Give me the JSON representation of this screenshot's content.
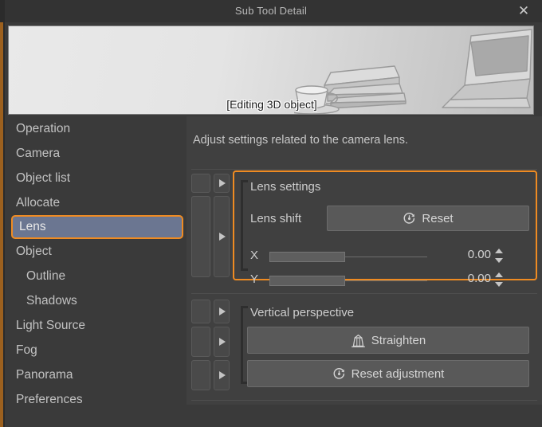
{
  "window": {
    "title": "Sub Tool Detail",
    "close_icon": "close-icon"
  },
  "preview": {
    "label": "[Editing 3D object]",
    "scene_objects": [
      "books",
      "coffee-cup",
      "laptop"
    ]
  },
  "sidebar": {
    "items": [
      {
        "label": "Operation",
        "selected": false,
        "sub": false
      },
      {
        "label": "Camera",
        "selected": false,
        "sub": false
      },
      {
        "label": "Object list",
        "selected": false,
        "sub": false
      },
      {
        "label": "Allocate",
        "selected": false,
        "sub": false
      },
      {
        "label": "Lens",
        "selected": true,
        "sub": false
      },
      {
        "label": "Object",
        "selected": false,
        "sub": false
      },
      {
        "label": "Outline",
        "selected": false,
        "sub": true
      },
      {
        "label": "Shadows",
        "selected": false,
        "sub": true
      },
      {
        "label": "Light Source",
        "selected": false,
        "sub": false
      },
      {
        "label": "Fog",
        "selected": false,
        "sub": false
      },
      {
        "label": "Panorama",
        "selected": false,
        "sub": false
      },
      {
        "label": "Preferences",
        "selected": false,
        "sub": false
      }
    ]
  },
  "content": {
    "description": "Adjust settings related to the camera lens.",
    "lens_settings": {
      "header": "Lens settings",
      "lens_shift_label": "Lens shift",
      "reset_button": "Reset",
      "reset_icon": "reset-clock-icon",
      "x_label": "X",
      "x_value": "0.00",
      "x_fill_percent": 48,
      "y_label": "Y",
      "y_value": "0.00",
      "y_fill_percent": 48
    },
    "vertical_perspective": {
      "header": "Vertical perspective",
      "straighten_button": "Straighten",
      "straighten_icon": "building-icon",
      "reset_adjustment_button": "Reset adjustment",
      "reset_adjustment_icon": "reset-clock-icon"
    }
  },
  "colors": {
    "accent_orange": "#ef8b22",
    "selection_blue": "#6b7691",
    "panel_bg": "#404040",
    "window_bg": "#3a3a3a",
    "titlebar_bg": "#333333"
  }
}
